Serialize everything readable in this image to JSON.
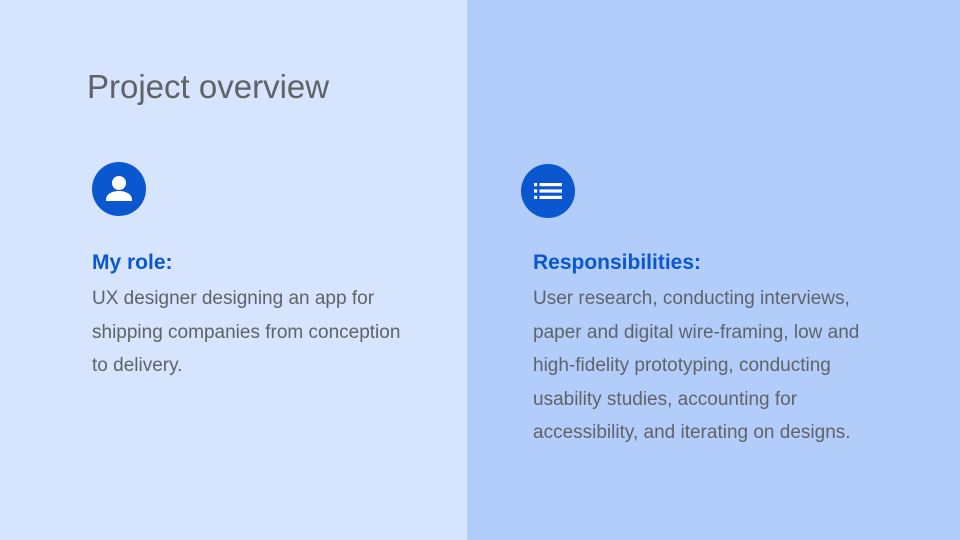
{
  "slide": {
    "title": "Project overview",
    "colors": {
      "left_background": "#d6e4fd",
      "right_background": "#b3cdfb",
      "accent": "#0b57d0",
      "text": "#5f6368"
    },
    "role": {
      "icon": "person-icon",
      "heading": "My role:",
      "lines": [
        "UX designer designing an app for",
        "shipping companies from conception",
        "to delivery."
      ]
    },
    "responsibilities": {
      "icon": "list-icon",
      "heading": "Responsibilities:",
      "lines": [
        "User research, conducting interviews,",
        "paper and digital wire-framing, low and",
        "high-fidelity prototyping, conducting",
        "usability studies, accounting for",
        "accessibility, and iterating on designs."
      ]
    }
  }
}
